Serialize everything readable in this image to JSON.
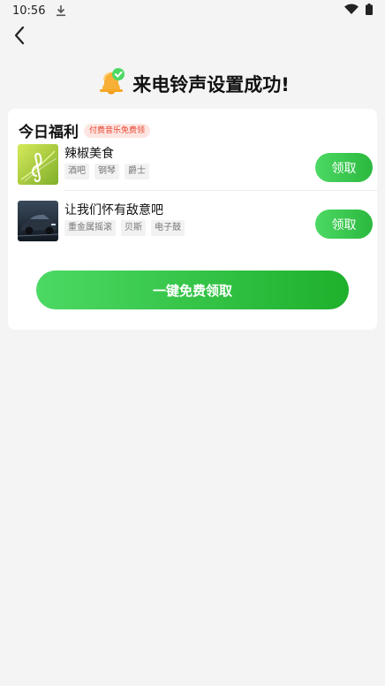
{
  "status_bar": {
    "time": "10:56",
    "icons": [
      "download-icon",
      "wifi-icon",
      "battery-icon"
    ]
  },
  "nav": {
    "back_icon": "chevron-left-icon"
  },
  "header": {
    "icon": "bell-check-icon",
    "title": "来电铃声设置成功!"
  },
  "welfare": {
    "title": "今日福利",
    "badge": "付费音乐免费领",
    "songs": [
      {
        "name": "辣椒美食",
        "tags": [
          "酒吧",
          "钢琴",
          "爵士"
        ],
        "claim_label": "领取",
        "cover": "music-note-cover"
      },
      {
        "name": "让我们怀有敌意吧",
        "tags": [
          "重金属摇滚",
          "贝斯",
          "电子鼓"
        ],
        "claim_label": "领取",
        "cover": "car-cover"
      }
    ],
    "claim_all_label": "一键免费领取"
  },
  "colors": {
    "accent_green": "#3ccc4f",
    "badge_red": "#e8452f",
    "background": "#f4f4f4"
  }
}
